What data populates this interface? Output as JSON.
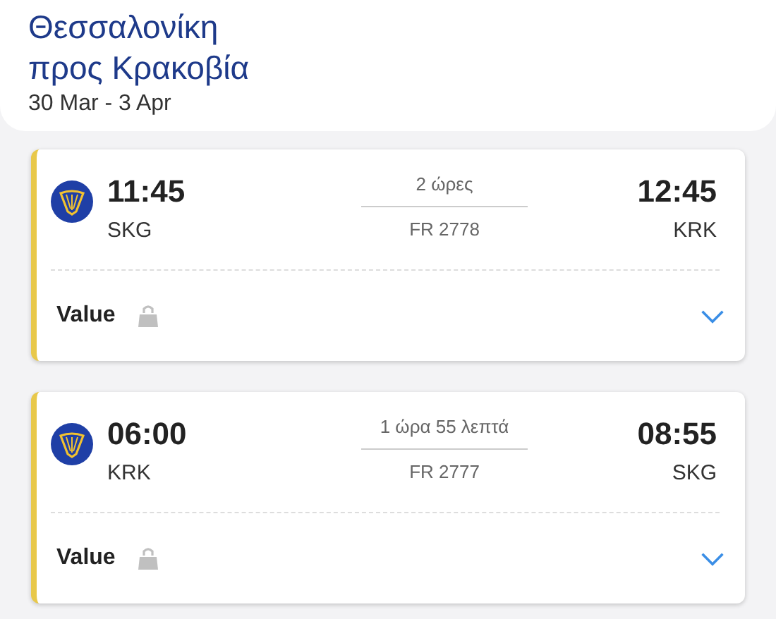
{
  "header": {
    "title_line_1": "Θεσσαλονίκη",
    "title_line_2": "προς Κρακοβία",
    "dates": "30 Mar - 3 Apr"
  },
  "flights": [
    {
      "departure_time": "11:45",
      "departure_airport": "SKG",
      "duration": "2 ώρες",
      "flight_number": "FR 2778",
      "arrival_time": "12:45",
      "arrival_airport": "KRK",
      "fare": "Value",
      "expanded": false
    },
    {
      "departure_time": "06:00",
      "departure_airport": "KRK",
      "duration": "1 ώρα 55 λεπτά",
      "flight_number": "FR 2777",
      "arrival_time": "08:55",
      "arrival_airport": "SKG",
      "fare": "Value",
      "expanded": false
    }
  ]
}
